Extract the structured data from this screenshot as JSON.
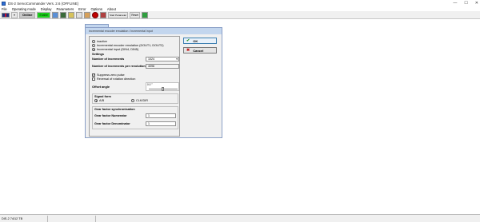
{
  "window": {
    "title": "DS-2 ServoCommander Vers. 2.6 (OFFLINE)",
    "minimize": "—",
    "maximize": "☐",
    "close": "✕"
  },
  "menu": [
    "File",
    "Operating mode",
    "Display",
    "Parameters",
    "Error",
    "Options",
    "About"
  ],
  "toolbar": {
    "online_label": "Online",
    "enable_label": "Enable",
    "start_param_label": "Start Parameter",
    "reset_label": "Reset"
  },
  "dialog": {
    "title": "Incremental encoder emulation / incremental input",
    "mode_options": [
      {
        "label": "inactive",
        "selected": false
      },
      {
        "label": "Incremental encoder emulation (DOUT1, DOUT2)",
        "selected": false
      },
      {
        "label": "Incremental input (DIN4, DIN5)",
        "selected": true
      }
    ],
    "settings_heading": "Settings",
    "num_increments_label": "Number of increments",
    "num_increments_value": "1024",
    "num_increments_per_rev_label": "Number of increments per revolution",
    "num_increments_per_rev_value": "4096",
    "suppress_zero_pulse_label": "Suppress zero pulse",
    "suppress_zero_pulse_checked": true,
    "reversal_label": "Reversal of rotation direction",
    "reversal_checked": false,
    "offset_label": "Offset angle",
    "offset_value": "0.0 °",
    "signal_form_heading": "Signal form",
    "signal_options": [
      {
        "label": "A/B",
        "selected": true
      },
      {
        "label": "CLK/DIR",
        "selected": false
      }
    ],
    "gear_heading": "Gear factor synchronisation",
    "gear_numerator_label": "Gear factor Numerator",
    "gear_numerator_value": "1",
    "gear_denominator_label": "Gear factor Denominator",
    "gear_denominator_value": "1",
    "ok_label": "OK",
    "cancel_label": "Cancel"
  },
  "statusbar": {
    "device": "DIS-2 74/12 TB"
  }
}
